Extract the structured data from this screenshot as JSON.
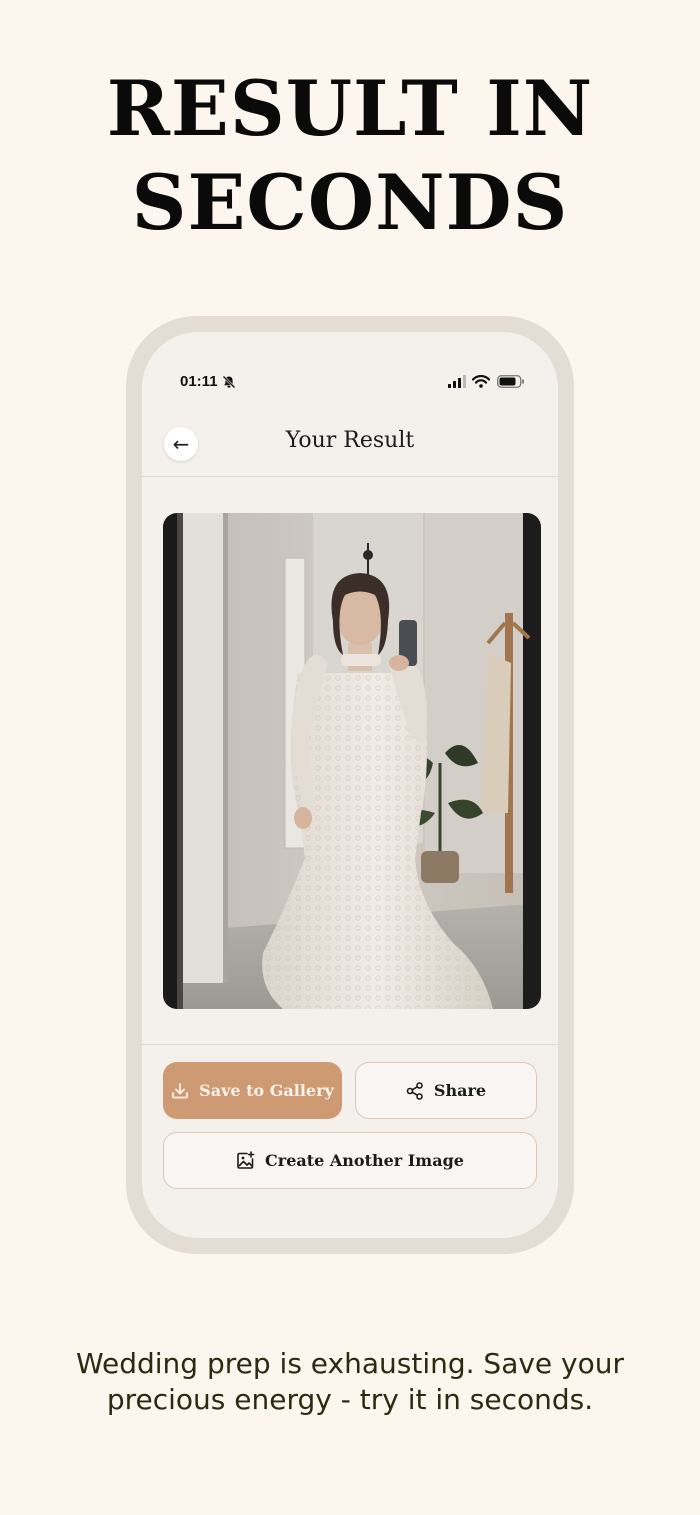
{
  "headline": {
    "line1": "RESULT IN",
    "line2": "SECONDS"
  },
  "status_bar": {
    "time": "01:11"
  },
  "nav": {
    "back_glyph": "←",
    "title": "Your Result"
  },
  "buttons": {
    "save_label": "Save to Gallery",
    "share_label": "Share",
    "create_label": "Create Another Image"
  },
  "tagline": {
    "line1": "Wedding prep is exhausting. Save your",
    "line2": "precious energy - try it in seconds."
  },
  "colors": {
    "background": "#fdf6ee",
    "phone_frame": "#e4ddd5",
    "screen": "#f4f0ec",
    "accent": "#cd9a73",
    "outline": "#dfc7b4",
    "tagline_text": "#2c2a12"
  },
  "icons": [
    "bell-slash-icon",
    "cellular-signal-icon",
    "wifi-icon",
    "battery-icon",
    "back-arrow-icon",
    "download-icon",
    "share-icon",
    "add-image-icon"
  ]
}
